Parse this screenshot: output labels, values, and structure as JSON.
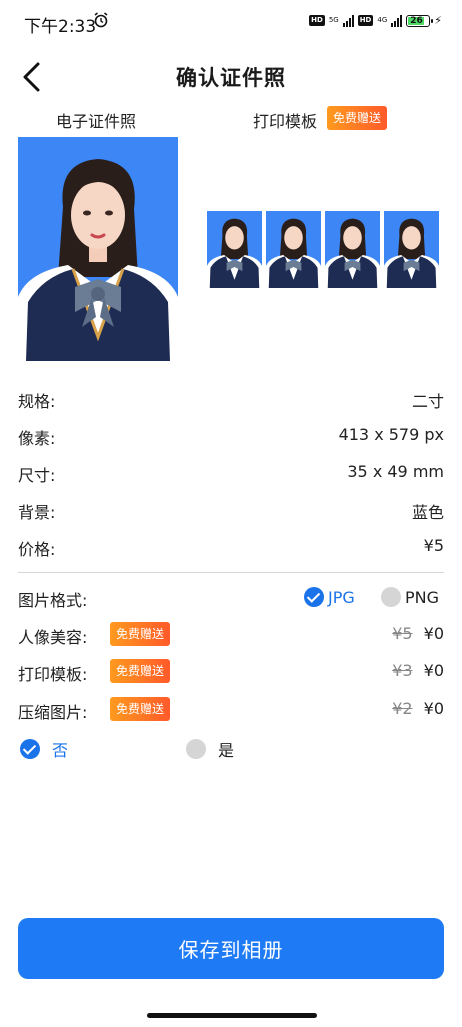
{
  "status_bar": {
    "time": "下午2:33",
    "net1": "5G",
    "net2": "4G",
    "battery": "26"
  },
  "header": {
    "title": "确认证件照"
  },
  "previews": {
    "digital_label": "电子证件照",
    "print_label": "打印模板",
    "print_badge": "免费赠送"
  },
  "specs": [
    {
      "key": "规格:",
      "value": "二寸"
    },
    {
      "key": "像素:",
      "value": "413 x 579 px"
    },
    {
      "key": "尺寸:",
      "value": "35 x 49 mm"
    },
    {
      "key": "背景:",
      "value": "蓝色"
    },
    {
      "key": "价格:",
      "value": "¥5"
    }
  ],
  "format": {
    "label": "图片格式:",
    "jpg": "JPG",
    "png": "PNG",
    "selected": "JPG"
  },
  "options": [
    {
      "label": "人像美容:",
      "badge": "免费赠送",
      "old_price": "¥5",
      "price": "¥0"
    },
    {
      "label": "打印模板:",
      "badge": "免费赠送",
      "old_price": "¥3",
      "price": "¥0"
    },
    {
      "label": "压缩图片:",
      "badge": "免费赠送",
      "old_price": "¥2",
      "price": "¥0"
    }
  ],
  "compress_choice": {
    "no": "否",
    "yes": "是",
    "selected": "否"
  },
  "save_button": "保存到相册",
  "colors": {
    "accent": "#1e7bf5",
    "photo_bg": "#3d86f6",
    "badge_from": "#ff9a1e",
    "badge_to": "#ff5a2a"
  }
}
